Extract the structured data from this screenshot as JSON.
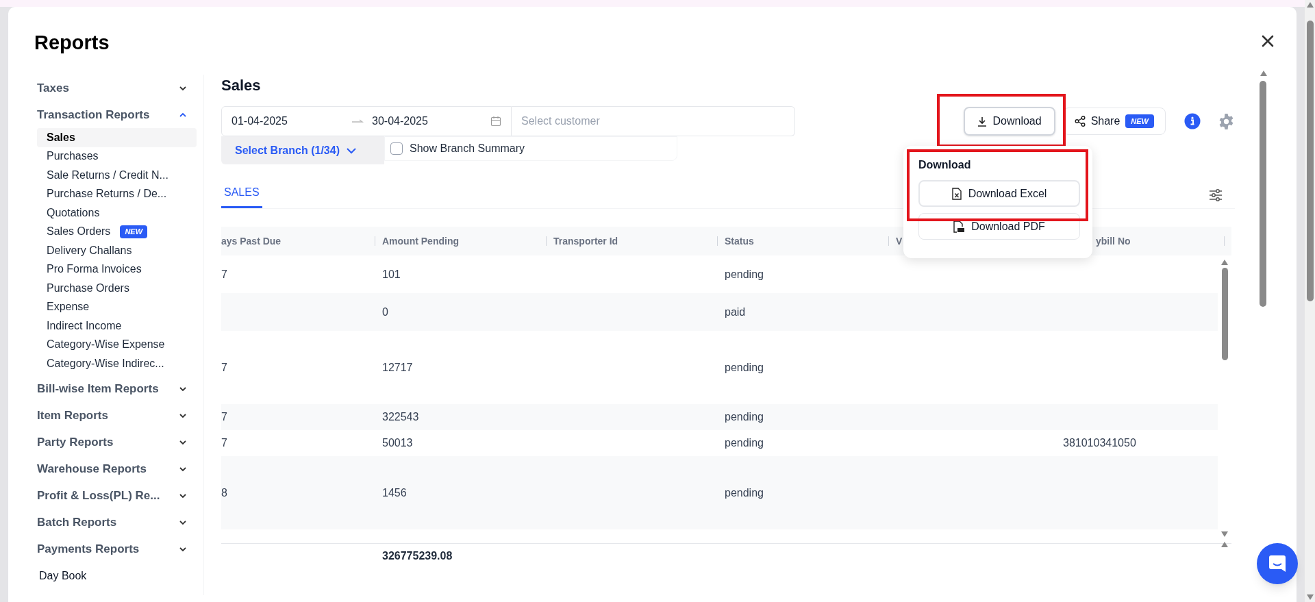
{
  "dialog": {
    "title": "Reports"
  },
  "sidebar": [
    {
      "kind": "group",
      "label": "Taxes",
      "expanded": false
    },
    {
      "kind": "group",
      "label": "Transaction Reports",
      "expanded": true,
      "items": [
        {
          "label": "Sales",
          "selected": true
        },
        {
          "label": "Purchases",
          "selected": false
        },
        {
          "label": "Sale Returns / Credit N...",
          "selected": false
        },
        {
          "label": "Purchase Returns / De...",
          "selected": false
        },
        {
          "label": "Quotations",
          "selected": false
        },
        {
          "label": "Sales Orders",
          "selected": false,
          "badge": "NEW"
        },
        {
          "label": "Delivery Challans",
          "selected": false
        },
        {
          "label": "Pro Forma Invoices",
          "selected": false
        },
        {
          "label": "Purchase Orders",
          "selected": false
        },
        {
          "label": "Expense",
          "selected": false
        },
        {
          "label": "Indirect Income",
          "selected": false
        },
        {
          "label": "Category-Wise Expense",
          "selected": false
        },
        {
          "label": "Category-Wise Indirec...",
          "selected": false
        }
      ]
    },
    {
      "kind": "group",
      "label": "Bill-wise Item Reports",
      "expanded": false
    },
    {
      "kind": "group",
      "label": "Item Reports",
      "expanded": false
    },
    {
      "kind": "group",
      "label": "Party Reports",
      "expanded": false
    },
    {
      "kind": "group",
      "label": "Warehouse Reports",
      "expanded": false
    },
    {
      "kind": "group",
      "label": "Profit & Loss(PL) Re...",
      "expanded": false
    },
    {
      "kind": "group",
      "label": "Batch Reports",
      "expanded": false
    },
    {
      "kind": "group",
      "label": "Payments Reports",
      "expanded": false
    },
    {
      "kind": "link",
      "label": "Day Book"
    }
  ],
  "main": {
    "title": "Sales",
    "date_range": {
      "start": "01-04-2025",
      "end": "30-04-2025"
    },
    "customer": {
      "placeholder": "Select customer"
    },
    "branch_button": "Select Branch (1/34)",
    "branch_summary": {
      "label": "Show Branch Summary",
      "checked": false
    },
    "download_button": "Download",
    "share_button": {
      "label": "Share",
      "badge": "NEW"
    },
    "tabs": [
      {
        "label": "SALES",
        "selected": true
      }
    ],
    "download_menu": {
      "title": "Download",
      "options": [
        {
          "kind": "excel",
          "label": "Download Excel"
        },
        {
          "kind": "pdf",
          "label": "Download PDF"
        }
      ]
    },
    "table": {
      "columns": [
        "ays Past Due",
        "Amount Pending",
        "Transporter Id",
        "Status",
        "V",
        "ybill No"
      ],
      "rows": [
        [
          "7",
          "101",
          null,
          "pending",
          null,
          null
        ],
        [
          null,
          "0",
          null,
          "paid",
          null,
          null
        ],
        [
          "7",
          "12717",
          null,
          "pending",
          null,
          null
        ],
        [
          "7",
          "322543",
          null,
          "pending",
          null,
          null
        ],
        [
          "7",
          "50013",
          null,
          "pending",
          null,
          "381010341050"
        ],
        [
          "8",
          "1456",
          null,
          "pending",
          null,
          null
        ]
      ],
      "total_amount_pending": "326775239.08"
    }
  }
}
